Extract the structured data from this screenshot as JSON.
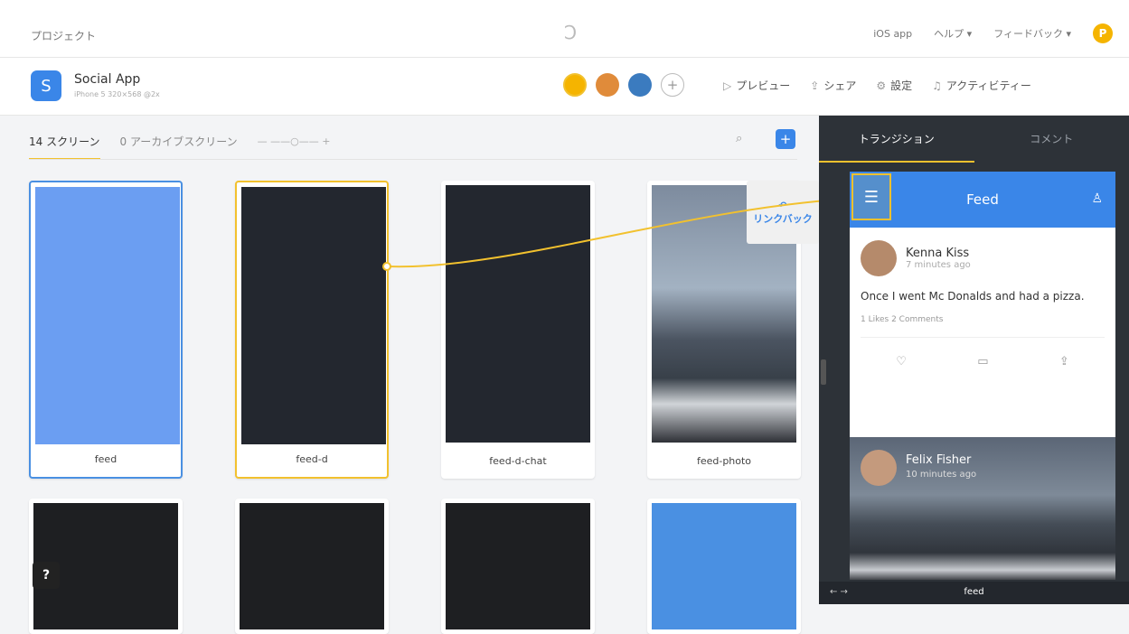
{
  "topbar": {
    "project_label": "プロジェクト",
    "ios_app": "iOS app",
    "help": "ヘルプ ▾",
    "feedback": "フィードバック ▾",
    "user_initial": "P"
  },
  "app": {
    "icon_letter": "S",
    "name": "Social App",
    "subtitle": "iPhone 5 320×568 @2x"
  },
  "actions": {
    "preview": "プレビュー",
    "share": "シェア",
    "settings": "設定",
    "activity": "アクティビティー"
  },
  "tabs": {
    "screens": "14 スクリーン",
    "archived": "0 アーカイブスクリーン"
  },
  "cards": [
    {
      "label": "feed"
    },
    {
      "label": "feed-d"
    },
    {
      "label": "feed-d-chat"
    },
    {
      "label": "feed-photo"
    }
  ],
  "link_back": "リンクバック",
  "right": {
    "tab_transition": "トランジション",
    "tab_comment": "コメント",
    "header": "Feed",
    "post1": {
      "name": "Kenna Kiss",
      "time": "7 minutes ago",
      "text": "Once I went Mc Donalds and had a pizza.",
      "stats": "1 Likes   2 Comments"
    },
    "post2": {
      "name": "Felix Fisher",
      "time": "10 minutes ago"
    },
    "footer": "feed"
  },
  "colors": {
    "accent": "#3a86e8",
    "highlight": "#f2c12e"
  }
}
